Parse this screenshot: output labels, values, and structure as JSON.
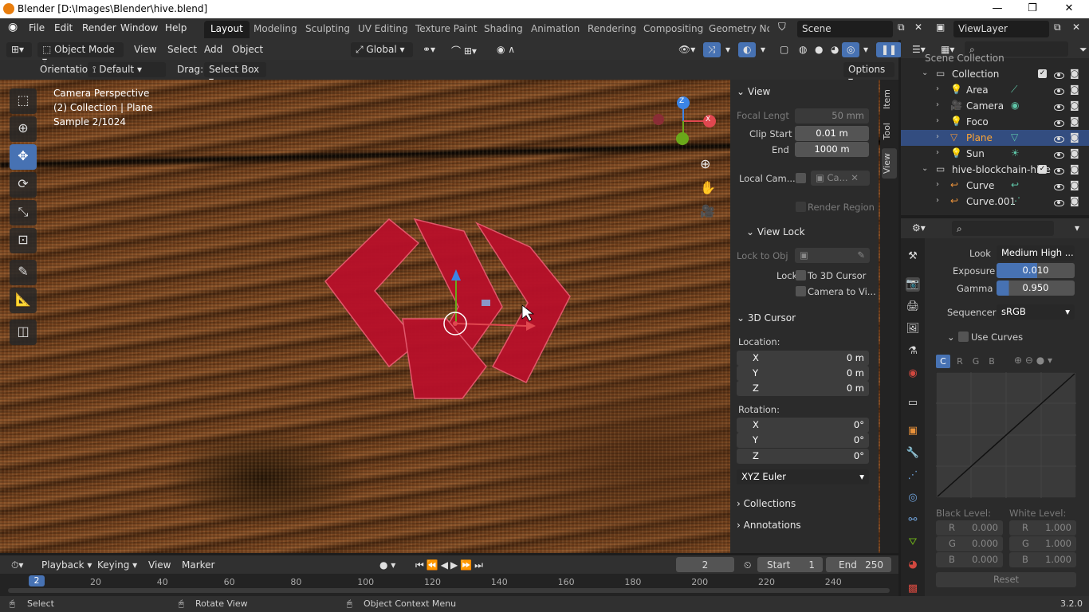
{
  "window": {
    "title": "Blender [D:\\Images\\Blender\\hive.blend]",
    "minimize": "—",
    "maximize": "❐",
    "close": "✕"
  },
  "menu": {
    "items": [
      "File",
      "Edit",
      "Render",
      "Window",
      "Help"
    ]
  },
  "workspaces": {
    "tabs": [
      "Layout",
      "Modeling",
      "Sculpting",
      "UV Editing",
      "Texture Paint",
      "Shading",
      "Animation",
      "Rendering",
      "Compositing",
      "Geometry Noc"
    ],
    "active": "Layout"
  },
  "scene": {
    "label": "Scene",
    "view_layer": "ViewLayer"
  },
  "viewport_header": {
    "mode": "Object Mode",
    "menus": [
      "View",
      "Select",
      "Add",
      "Object"
    ],
    "orientation_global": "Global"
  },
  "tool_header": {
    "orientation_label": "Orientation:",
    "orientation_value": "Default",
    "drag_label": "Drag:",
    "drag_value": "Select Box",
    "options": "Options"
  },
  "viewport_overlay": {
    "line1": "Camera Perspective",
    "line2": "(2) Collection | Plane",
    "line3": "Sample 2/1024"
  },
  "gizmo": {
    "x": "X",
    "y": "Y",
    "z": "Z"
  },
  "npanel": {
    "tabs": [
      "Item",
      "Tool",
      "View"
    ],
    "active_tab": "View",
    "view_section": "View",
    "focal_label": "Focal Lengt",
    "focal_value": "50 mm",
    "clip_start_label": "Clip Start",
    "clip_start_value": "0.01 m",
    "clip_end_label": "End",
    "clip_end_value": "1000 m",
    "local_cam_label": "Local Cam...",
    "local_cam_value": "Ca...",
    "render_region": "Render Region",
    "view_lock_section": "View Lock",
    "lock_obj_label": "Lock to Obj",
    "lock_label": "Lock",
    "lock_3d_cursor": "To 3D Cursor",
    "lock_camera": "Camera to Vi...",
    "cursor_section": "3D Cursor",
    "location_label": "Location:",
    "loc": [
      {
        "axis": "X",
        "value": "0 m"
      },
      {
        "axis": "Y",
        "value": "0 m"
      },
      {
        "axis": "Z",
        "value": "0 m"
      }
    ],
    "rotation_label": "Rotation:",
    "rot": [
      {
        "axis": "X",
        "value": "0°"
      },
      {
        "axis": "Y",
        "value": "0°"
      },
      {
        "axis": "Z",
        "value": "0°"
      }
    ],
    "rotation_mode": "XYZ Euler",
    "collections_section": "Collections",
    "annotations_section": "Annotations"
  },
  "timeline": {
    "menus": [
      "Playback",
      "Keying",
      "View",
      "Marker"
    ],
    "current_frame": "2",
    "start_label": "Start",
    "start_value": "1",
    "end_label": "End",
    "end_value": "250",
    "ticks": [
      "20",
      "40",
      "60",
      "80",
      "100",
      "120",
      "140",
      "160",
      "180",
      "200",
      "220",
      "240"
    ],
    "playhead": "2"
  },
  "status": {
    "select": "Select",
    "rotate": "Rotate View",
    "context": "Object Context Menu",
    "version": "3.2.0"
  },
  "outliner": {
    "root": "Scene Collection",
    "rows": [
      {
        "name": "Collection",
        "indent": 0
      },
      {
        "name": "Area",
        "indent": 1
      },
      {
        "name": "Camera",
        "indent": 1
      },
      {
        "name": "Foco",
        "indent": 1
      },
      {
        "name": "Plane",
        "indent": 1,
        "selected": true
      },
      {
        "name": "Sun",
        "indent": 1
      },
      {
        "name": "hive-blockchain-hive",
        "indent": 0
      },
      {
        "name": "Curve",
        "indent": 1
      },
      {
        "name": "Curve.001",
        "indent": 1
      }
    ]
  },
  "properties": {
    "look_label": "Look",
    "look_value": "Medium High ...",
    "exposure_label": "Exposure",
    "exposure_value": "0.010",
    "gamma_label": "Gamma",
    "gamma_value": "0.950",
    "sequencer_label": "Sequencer",
    "sequencer_value": "sRGB",
    "use_curves": "Use Curves",
    "curve_channels": [
      "C",
      "R",
      "G",
      "B"
    ],
    "black_level": "Black Level:",
    "white_level": "White Level:",
    "black": [
      {
        "c": "R",
        "v": "0.000"
      },
      {
        "c": "G",
        "v": "0.000"
      },
      {
        "c": "B",
        "v": "0.000"
      }
    ],
    "white": [
      {
        "c": "R",
        "v": "1.000"
      },
      {
        "c": "G",
        "v": "1.000"
      },
      {
        "c": "B",
        "v": "1.000"
      }
    ],
    "reset": "Reset"
  },
  "colors": {
    "accent": "#4772b3",
    "selection": "#334d80",
    "object_red": "#c8102e",
    "x_axis": "#e0474f",
    "y_axis": "#6aa81a",
    "z_axis": "#3b84e6"
  }
}
